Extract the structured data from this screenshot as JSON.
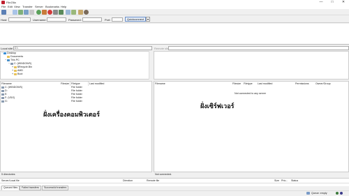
{
  "window": {
    "title": "FileZilla",
    "minimize": "—",
    "maximize": "□",
    "close": "✕"
  },
  "menu": [
    "File",
    "Edit",
    "View",
    "Transfer",
    "Server",
    "Bookmarks",
    "Help"
  ],
  "quickconnect": {
    "host_label": "Host:",
    "username_label": "Username:",
    "password_label": "Password:",
    "port_label": "Port:",
    "button_label": "Quickconnect",
    "dropdown": "▾"
  },
  "local_site": {
    "label": "Local site:",
    "value": "C:\\"
  },
  "remote_site": {
    "label": "Remote site:",
    "value": ""
  },
  "local_tree": [
    {
      "label": "Desktop",
      "icon": "desktop-icon",
      "indent": 0,
      "expander": "−"
    },
    {
      "label": "Documents",
      "icon": "folder-icon",
      "indent": 1,
      "expander": ""
    },
    {
      "label": "This PC",
      "icon": "pc-icon",
      "indent": 1,
      "expander": "−"
    },
    {
      "label": "C: (WINDOWS)",
      "icon": "drive-icon",
      "indent": 2,
      "expander": "−"
    },
    {
      "label": "$Recycle.Bin",
      "icon": "folder-icon",
      "indent": 3,
      "expander": "+"
    },
    {
      "label": "AMD",
      "icon": "folder-icon",
      "indent": 3,
      "expander": "+"
    },
    {
      "label": "Boot",
      "icon": "folder-icon",
      "indent": 3,
      "expander": "+"
    }
  ],
  "local_list": {
    "columns": [
      "Filename",
      "Filesize",
      "Filetype",
      "Last modified"
    ],
    "rows": [
      {
        "name": "C: (WINDOWS)",
        "type": "File folder"
      },
      {
        "name": "D:",
        "type": "File folder"
      },
      {
        "name": "E:",
        "type": "File folder"
      },
      {
        "name": "F: (VDO)",
        "type": "File folder"
      },
      {
        "name": "G:",
        "type": "File folder"
      }
    ],
    "overlay_label": "ฝั่งเครื่องคอมพิวเตอร์",
    "status": "5 directories"
  },
  "remote_list": {
    "columns": [
      "Filename",
      "Filesize",
      "Filetype",
      "Last modified",
      "Permissions",
      "Owner/Group"
    ],
    "empty_message": "Not connected to any server",
    "overlay_label": "ฝั่งเซิร์ฟเวอร์",
    "status": "Not connected."
  },
  "queue": {
    "columns": [
      "Server/Local file",
      "Direction",
      "Remote file",
      "Size",
      "Prio...",
      "Status"
    ],
    "tabs": [
      "Queued files",
      "Failed transfers",
      "Successful transfers"
    ],
    "status": "Queue: empty"
  },
  "colors": {
    "folder": "#e8c35a",
    "brand": "#bf1e2e",
    "accent": "#6a8fc8"
  }
}
